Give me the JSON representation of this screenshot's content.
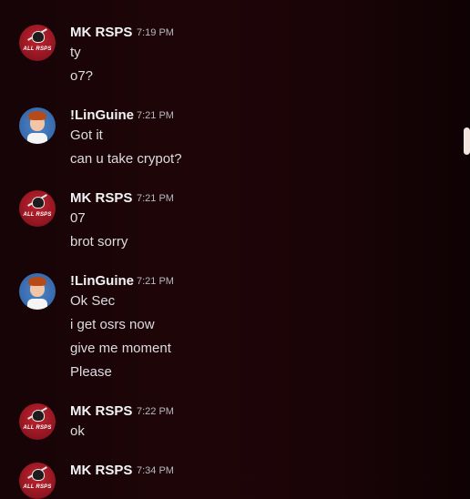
{
  "groups": [
    {
      "author": "MK RSPS",
      "time": "7:19 PM",
      "avatar_label": "ALL RSPS",
      "lines": [
        "ty",
        "o7?"
      ]
    },
    {
      "author": "!LinGuine",
      "time": "7:21 PM",
      "lines": [
        "Got it",
        "can u take crypot?"
      ]
    },
    {
      "author": "MK RSPS",
      "time": "7:21 PM",
      "avatar_label": "ALL RSPS",
      "lines": [
        "07",
        "brot sorry"
      ]
    },
    {
      "author": "!LinGuine",
      "time": "7:21 PM",
      "lines": [
        "Ok Sec",
        "i get osrs now",
        "give me moment",
        "Please"
      ]
    },
    {
      "author": "MK RSPS",
      "time": "7:22 PM",
      "avatar_label": "ALL RSPS",
      "lines": [
        "ok"
      ]
    },
    {
      "author": "MK RSPS",
      "time": "7:34 PM",
      "avatar_label": "ALL RSPS",
      "lines": []
    }
  ]
}
